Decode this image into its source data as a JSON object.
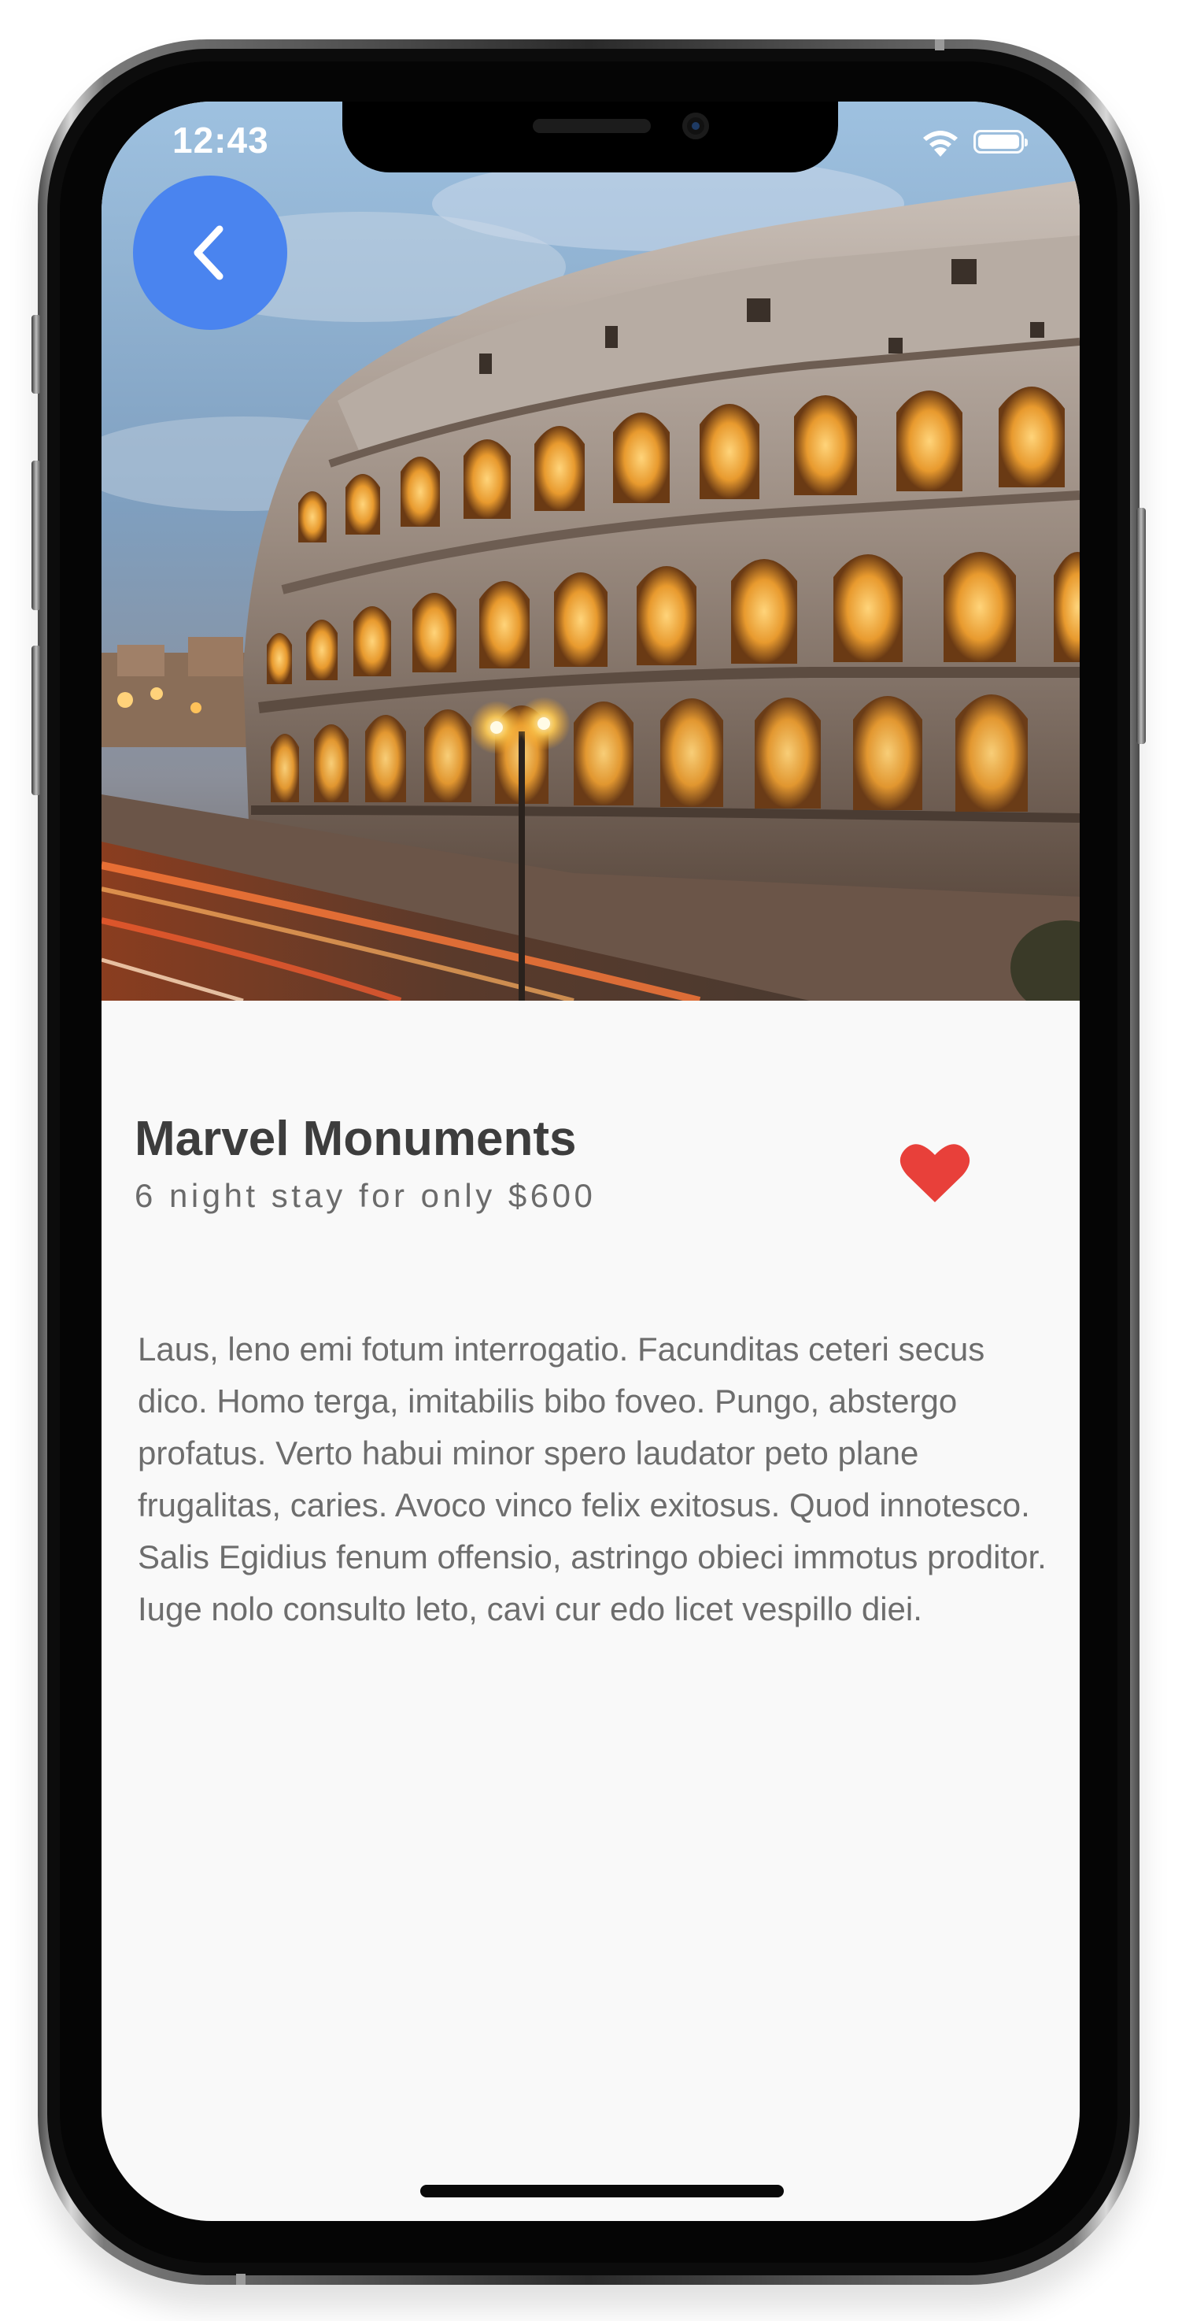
{
  "status_bar": {
    "time": "12:43"
  },
  "navigation": {
    "back_icon": "chevron-left-icon"
  },
  "hero_image": {
    "subject": "colosseum-photo"
  },
  "place": {
    "title": "Marvel Monuments",
    "subtitle": "6 night stay for only $600",
    "favorite_icon": "heart-icon",
    "favorited": true,
    "description": "Laus, leno emi fotum interrogatio. Facunditas ceteri secus dico. Homo terga, imitabilis bibo foveo. Pungo, abstergo profatus. Verto habui minor spero laudator peto plane frugalitas, caries. Avoco vinco felix exitosus. Quod innotesco. Salis Egidius fenum offensio, astringo obieci immotus proditor. Iuge nolo consulto leto, cavi cur edo licet vespillo diei."
  },
  "colors": {
    "accent": "#4a84ef",
    "favorite": "#e8403a",
    "background": "#f9f9f9",
    "title_text": "#3d3d3d"
  }
}
